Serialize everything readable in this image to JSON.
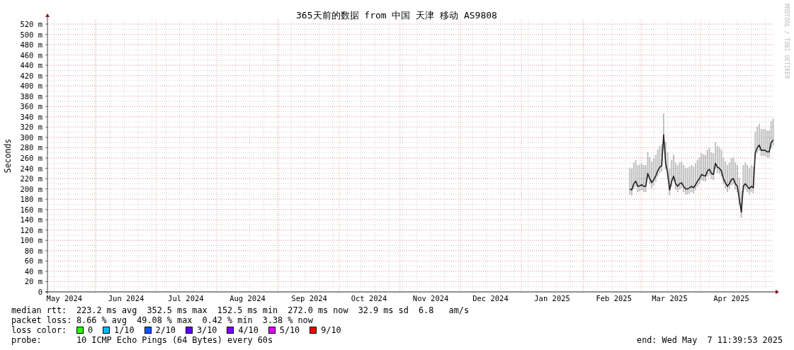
{
  "graph": {
    "credit": "RRDTOOL / TOBI OETIKER",
    "chart_data": {
      "type": "line",
      "title": "365天前的数据 from 中国 天津 移动 AS9808",
      "ylabel": "Seconds",
      "grid": true,
      "ylim": [
        0,
        520
      ],
      "yticks": [
        {
          "value": 0,
          "label": "0"
        },
        {
          "value": 20,
          "label": "20 m"
        },
        {
          "value": 40,
          "label": "40 m"
        },
        {
          "value": 60,
          "label": "60 m"
        },
        {
          "value": 80,
          "label": "80 m"
        },
        {
          "value": 100,
          "label": "100 m"
        },
        {
          "value": 120,
          "label": "120 m"
        },
        {
          "value": 140,
          "label": "140 m"
        },
        {
          "value": 160,
          "label": "160 m"
        },
        {
          "value": 180,
          "label": "180 m"
        },
        {
          "value": 200,
          "label": "200 m"
        },
        {
          "value": 220,
          "label": "220 m"
        },
        {
          "value": 240,
          "label": "240 m"
        },
        {
          "value": 260,
          "label": "260 m"
        },
        {
          "value": 280,
          "label": "280 m"
        },
        {
          "value": 300,
          "label": "300 m"
        },
        {
          "value": 320,
          "label": "320 m"
        },
        {
          "value": 340,
          "label": "340 m"
        },
        {
          "value": 360,
          "label": "360 m"
        },
        {
          "value": 380,
          "label": "380 m"
        },
        {
          "value": 400,
          "label": "400 m"
        },
        {
          "value": 420,
          "label": "420 m"
        },
        {
          "value": 440,
          "label": "440 m"
        },
        {
          "value": 460,
          "label": "460 m"
        },
        {
          "value": 480,
          "label": "480 m"
        },
        {
          "value": 500,
          "label": "500 m"
        },
        {
          "value": 520,
          "label": "520 m"
        }
      ],
      "categories": [
        null,
        null,
        null,
        null,
        null,
        null,
        null,
        null,
        "May 2024",
        null,
        null,
        null,
        null,
        null,
        null,
        null,
        null,
        null,
        null,
        null,
        null,
        null,
        null,
        null,
        null,
        null,
        null,
        null,
        null,
        null,
        null,
        null,
        null,
        null,
        null,
        null,
        null,
        null,
        null,
        "Jun 2024",
        null,
        null,
        null,
        null,
        null,
        null,
        null,
        null,
        null,
        null,
        null,
        null,
        null,
        null,
        null,
        null,
        null,
        null,
        null,
        null,
        null,
        null,
        null,
        null,
        null,
        null,
        null,
        null,
        null,
        "Jul 2024",
        null,
        null,
        null,
        null,
        null,
        null,
        null,
        null,
        null,
        null,
        null,
        null,
        null,
        null,
        null,
        null,
        null,
        null,
        null,
        null,
        null,
        null,
        null,
        null,
        null,
        null,
        null,
        null,
        null,
        null,
        "Aug 2024",
        null,
        null,
        null,
        null,
        null,
        null,
        null,
        null,
        null,
        null,
        null,
        null,
        null,
        null,
        null,
        null,
        null,
        null,
        null,
        null,
        null,
        null,
        null,
        null,
        null,
        null,
        null,
        null,
        null,
        null,
        "Sep 2024",
        null,
        null,
        null,
        null,
        null,
        null,
        null,
        null,
        null,
        null,
        null,
        null,
        null,
        null,
        null,
        null,
        null,
        null,
        null,
        null,
        null,
        null,
        null,
        null,
        null,
        null,
        null,
        null,
        null,
        "Oct 2024",
        null,
        null,
        null,
        null,
        null,
        null,
        null,
        null,
        null,
        null,
        null,
        null,
        null,
        null,
        null,
        null,
        null,
        null,
        null,
        null,
        null,
        null,
        null,
        null,
        null,
        null,
        null,
        null,
        null,
        null,
        "Nov 2024",
        null,
        null,
        null,
        null,
        null,
        null,
        null,
        null,
        null,
        null,
        null,
        null,
        null,
        null,
        null,
        null,
        null,
        null,
        null,
        null,
        null,
        null,
        null,
        null,
        null,
        null,
        null,
        null,
        null,
        "Dec 2024",
        null,
        null,
        null,
        null,
        null,
        null,
        null,
        null,
        null,
        null,
        null,
        null,
        null,
        null,
        null,
        null,
        null,
        null,
        null,
        null,
        null,
        null,
        null,
        null,
        null,
        null,
        null,
        null,
        null,
        null,
        "Jan 2025",
        null,
        null,
        null,
        null,
        null,
        null,
        null,
        null,
        null,
        null,
        null,
        null,
        null,
        null,
        null,
        null,
        null,
        null,
        null,
        null,
        null,
        null,
        null,
        null,
        null,
        null,
        null,
        null,
        null,
        null,
        "Feb 2025",
        null,
        null,
        null,
        null,
        null,
        null,
        null,
        null,
        null,
        null,
        null,
        null,
        null,
        null,
        null,
        null,
        null,
        null,
        null,
        null,
        null,
        null,
        null,
        null,
        null,
        null,
        null,
        "Mar 2025",
        null,
        null,
        null,
        null,
        null,
        null,
        null,
        null,
        null,
        null,
        null,
        null,
        null,
        null,
        null,
        null,
        null,
        null,
        null,
        null,
        null,
        null,
        null,
        null,
        null,
        null,
        null,
        null,
        null,
        null,
        "Apr 2025",
        null,
        null,
        null,
        null,
        null,
        null,
        null,
        null,
        null,
        null,
        null,
        null,
        null,
        null,
        null,
        null,
        null,
        null,
        null,
        null,
        null
      ],
      "series": [
        {
          "color": "#202020",
          "values": [
            null,
            null,
            null,
            null,
            null,
            null,
            null,
            null,
            null,
            null,
            null,
            null,
            null,
            null,
            null,
            null,
            null,
            null,
            null,
            null,
            null,
            null,
            null,
            null,
            null,
            null,
            null,
            null,
            null,
            null,
            null,
            null,
            null,
            null,
            null,
            null,
            null,
            null,
            null,
            null,
            null,
            null,
            null,
            null,
            null,
            null,
            null,
            null,
            null,
            null,
            null,
            null,
            null,
            null,
            null,
            null,
            null,
            null,
            null,
            null,
            null,
            null,
            null,
            null,
            null,
            null,
            null,
            null,
            null,
            null,
            null,
            null,
            null,
            null,
            null,
            null,
            null,
            null,
            null,
            null,
            null,
            null,
            null,
            null,
            null,
            null,
            null,
            null,
            null,
            null,
            null,
            null,
            null,
            null,
            null,
            null,
            null,
            null,
            null,
            null,
            null,
            null,
            null,
            null,
            null,
            null,
            null,
            null,
            null,
            null,
            null,
            null,
            null,
            null,
            null,
            null,
            null,
            null,
            null,
            null,
            null,
            null,
            null,
            null,
            null,
            null,
            null,
            null,
            null,
            null,
            null,
            null,
            null,
            null,
            null,
            null,
            null,
            null,
            null,
            null,
            null,
            null,
            null,
            null,
            null,
            null,
            null,
            null,
            null,
            null,
            null,
            null,
            null,
            null,
            null,
            null,
            null,
            null,
            null,
            null,
            null,
            null,
            null,
            null,
            null,
            null,
            null,
            null,
            null,
            null,
            null,
            null,
            null,
            null,
            null,
            null,
            null,
            null,
            null,
            null,
            null,
            null,
            null,
            null,
            null,
            null,
            null,
            null,
            null,
            null,
            null,
            null,
            null,
            null,
            null,
            null,
            null,
            null,
            null,
            null,
            null,
            null,
            null,
            null,
            null,
            null,
            null,
            null,
            null,
            null,
            null,
            null,
            null,
            null,
            null,
            null,
            null,
            null,
            null,
            null,
            null,
            null,
            null,
            null,
            null,
            null,
            null,
            null,
            null,
            null,
            null,
            null,
            null,
            null,
            null,
            null,
            null,
            null,
            null,
            null,
            null,
            null,
            null,
            null,
            null,
            null,
            null,
            null,
            null,
            null,
            null,
            null,
            null,
            null,
            null,
            null,
            null,
            null,
            null,
            null,
            null,
            null,
            null,
            null,
            null,
            null,
            null,
            null,
            null,
            null,
            null,
            null,
            null,
            null,
            null,
            null,
            null,
            null,
            null,
            null,
            null,
            null,
            null,
            null,
            null,
            null,
            null,
            null,
            null,
            null,
            null,
            null,
            200,
            198,
            210,
            215,
            205,
            206,
            208,
            205,
            205,
            230,
            220,
            212,
            218,
            225,
            235,
            242,
            245,
            305,
            250,
            230,
            198,
            215,
            225,
            210,
            205,
            210,
            212,
            205,
            200,
            200,
            202,
            205,
            202,
            208,
            215,
            220,
            228,
            226,
            225,
            235,
            238,
            230,
            228,
            250,
            242,
            240,
            235,
            220,
            212,
            205,
            210,
            218,
            220,
            210,
            205,
            180,
            155,
            205,
            210,
            205,
            200,
            205,
            202,
            270,
            280,
            285,
            275,
            275,
            275,
            272,
            272,
            290,
            295
          ]
        }
      ]
    }
  },
  "stats": [
    {
      "label": "median rtt:",
      "text": "223.2 ms avg  352.5 ms max  152.5 ms min  272.0 ms now  32.9 ms sd  6.8   am/s"
    },
    {
      "label": "packet loss:",
      "text": "8.66 % avg  49.08 % max  0.42 % min  3.38 % now"
    }
  ],
  "loss_colors": {
    "label": "loss color:",
    "items": [
      {
        "label": "0",
        "color": "#26ff00"
      },
      {
        "label": "1/10",
        "color": "#00b8ff"
      },
      {
        "label": "2/10",
        "color": "#0059ff"
      },
      {
        "label": "3/10",
        "color": "#5e00ff"
      },
      {
        "label": "4/10",
        "color": "#7e00ff"
      },
      {
        "label": "5/10",
        "color": "#dd00ff"
      },
      {
        "label": "9/10",
        "color": "#ff0000"
      }
    ]
  },
  "probe": {
    "label": "probe:",
    "text": "10 ICMP Echo Pings (64 Bytes) every 60s"
  },
  "end": "end: Wed May  7 11:39:53 2025"
}
